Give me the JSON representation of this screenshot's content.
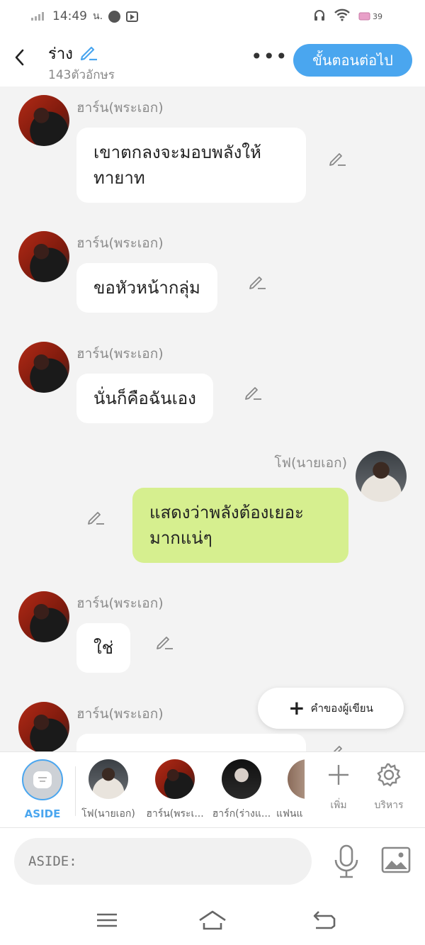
{
  "status_bar": {
    "time": "14:49",
    "time_suffix": "น.",
    "battery": "39"
  },
  "header": {
    "title": "ร่าง",
    "char_count": "143ตัวอักษร",
    "next_button": "ขั้นตอนต่อไป"
  },
  "messages": [
    {
      "sender": "ฮาร์น(พระเอก)",
      "text": "เขาตกลงจะมอบพลังให้ทายาท",
      "side": "left"
    },
    {
      "sender": "ฮาร์น(พระเอก)",
      "text": "ขอหัวหน้ากลุ่ม",
      "side": "left"
    },
    {
      "sender": "ฮาร์น(พระเอก)",
      "text": "นั่นก็คือฉันเอง",
      "side": "left"
    },
    {
      "sender": "โฟ(นายเอก)",
      "text": "แสดงว่าพลังต้องเยอะมากแน่ๆ",
      "side": "right"
    },
    {
      "sender": "ฮาร์น(พระเอก)",
      "text": "ใช่",
      "side": "left"
    },
    {
      "sender": "ฮาร์น(พระเอก)",
      "text": "",
      "side": "left"
    }
  ],
  "fab": {
    "label": "คำของผู้เขียน"
  },
  "characters": {
    "aside_label": "ASIDE",
    "items": [
      {
        "name": "โฟ(นายเอก)"
      },
      {
        "name": "ฮาร์น(พระเ..."
      },
      {
        "name": "ฮาร์ก(ร่างแ..."
      },
      {
        "name": "แฟนแ"
      }
    ],
    "add_label": "เพิ่ม",
    "manage_label": "บริหาร"
  },
  "input": {
    "placeholder": "ASIDE:"
  },
  "colors": {
    "accent": "#4aa6ef",
    "my_bubble": "#d6ef8f",
    "background": "#f3f3f3"
  }
}
